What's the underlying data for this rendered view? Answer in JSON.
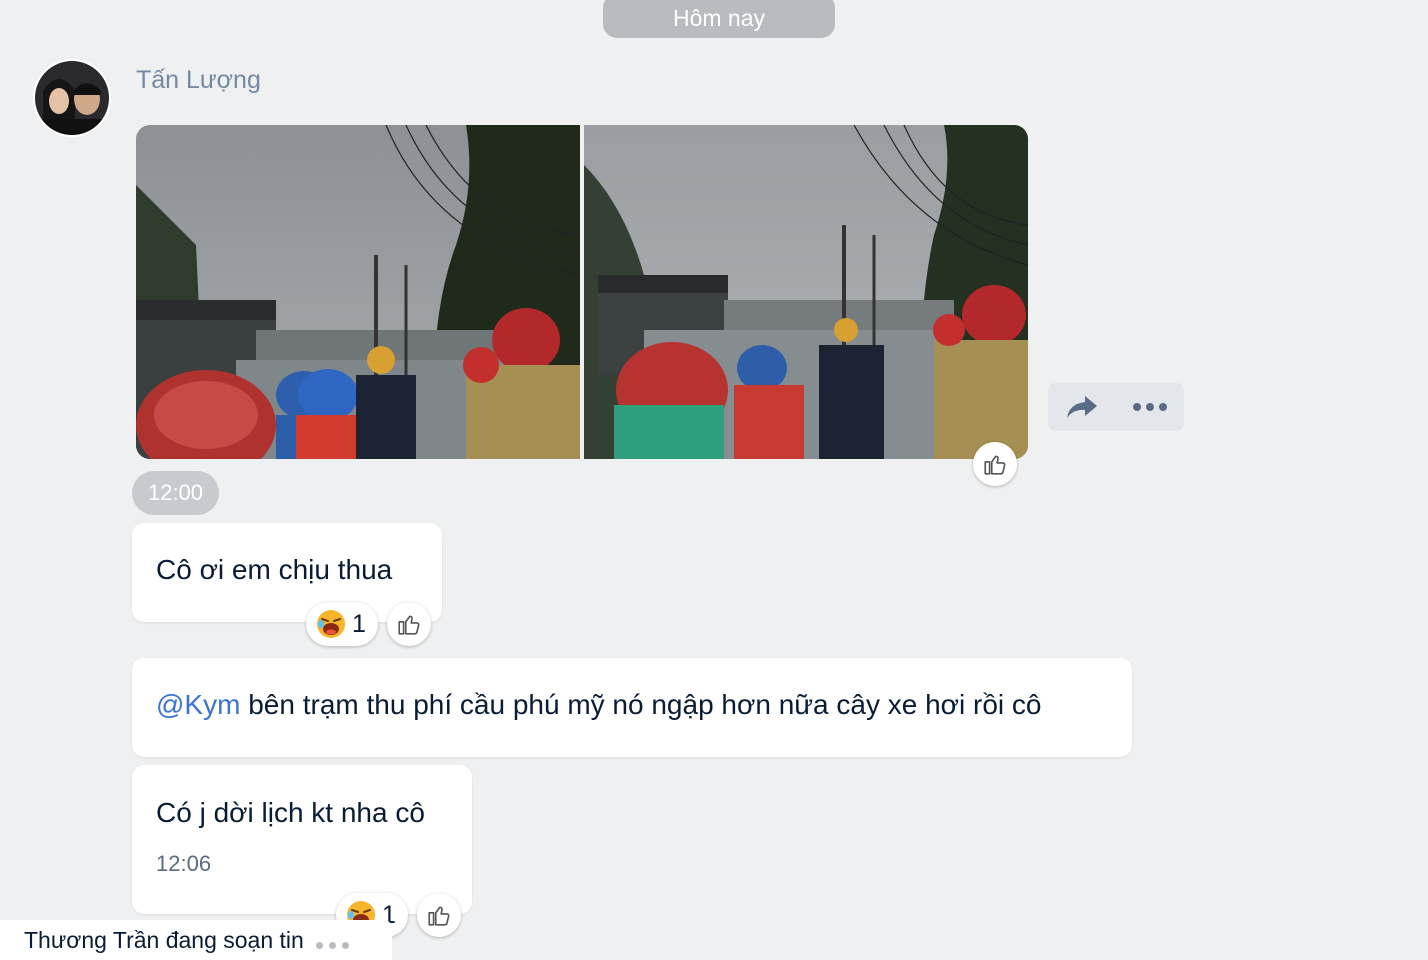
{
  "date_separator": "Hôm nay",
  "sender": {
    "name": "Tấn Lượng"
  },
  "photo_message": {
    "images": [
      "photo-1",
      "photo-2"
    ]
  },
  "time_pill": "12:00",
  "messages": [
    {
      "text": "Cô ơi em chịu thua",
      "reaction_emoji": "laughing-face",
      "reaction_count": "1"
    },
    {
      "mention": "@Kym",
      "text": " bên trạm thu phí cầu phú mỹ nó ngập hơn nữa cây xe hơi rồi cô"
    },
    {
      "text": "Có j dời lịch kt nha cô",
      "time": "12:06",
      "reaction_emoji": "laughing-face",
      "reaction_count": "1"
    }
  ],
  "typing_indicator": "Thương Trần đang soạn tin",
  "icons": {
    "share": "share-icon",
    "more": "more-icon",
    "like": "thumbs-up-icon"
  },
  "colors": {
    "background": "#eef0f1",
    "mention": "#3b74d4",
    "pill": "#b8bcc1"
  }
}
